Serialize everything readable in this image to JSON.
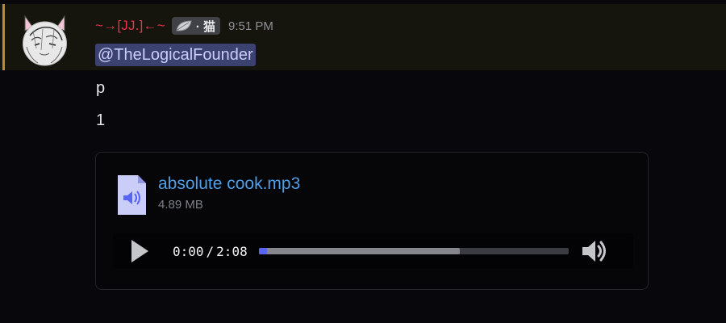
{
  "message": {
    "author": {
      "name": "~→[JJ.]←~",
      "tag": "· 猫",
      "avatar_icon": "manga-cat-avatar-icon",
      "name_color": "#e8344a"
    },
    "timestamp": "9:51 PM",
    "mention": "@TheLogicalFounder",
    "lines": [
      "p",
      "1"
    ]
  },
  "attachment": {
    "icon": "audio-file-icon",
    "file_name": "absolute cook.mp3",
    "file_size": "4.89 MB",
    "player": {
      "current_time": "0:00",
      "separator": "/",
      "duration": "2:08",
      "progress": 0,
      "buffered": 0.65,
      "play_icon": "play-icon",
      "volume_icon": "volume-icon"
    }
  },
  "colors": {
    "accent": "#5865f2",
    "link": "#4e9ee8",
    "mention_bg": "#3c4270",
    "mention_bar": "#c4892c"
  }
}
